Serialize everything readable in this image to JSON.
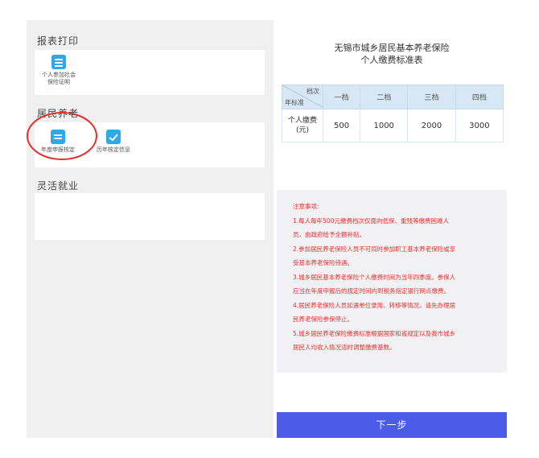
{
  "left": {
    "sections": {
      "print": {
        "title": "报表打印"
      },
      "pension": {
        "title": "居民养老"
      },
      "flex": {
        "title": "灵活就业"
      }
    },
    "tiles": {
      "insurance_cert": {
        "label_line1": "个人参加社会",
        "label_line2": "保险证明",
        "icon": "document-icon"
      },
      "annual_declare": {
        "label": "年度申报核定",
        "icon": "calendar-icon"
      },
      "history_check": {
        "label": "历年核定信息",
        "icon": "checked-calendar-icon"
      }
    }
  },
  "right": {
    "title_line1": "无锡市城乡居民基本养老保险",
    "title_line2": "个人缴费标准表",
    "table": {
      "corner_top": "档次",
      "corner_bottom": "年标准",
      "columns": [
        "一档",
        "二档",
        "三档",
        "四档"
      ],
      "row_label_line1": "个人缴费",
      "row_label_line2": "(元)",
      "values": [
        "500",
        "1000",
        "2000",
        "3000"
      ]
    },
    "notes": [
      "注意事项:",
      "1.每人每年500元缴费档次仅面向低保、重残等缴费困难人",
      "员，由政府给予全额补贴。",
      "2.参加居民养老保险人员不可同时参加职工基本养老保险或享",
      "受基本养老保险待遇。",
      "3.城乡居民基本养老保险个人缴费时间为当年四季度。参保人",
      "应当在年度申报后的规定时间内到税务指定银行网点缴费。",
      "4.居民养老保险人员如遇单位录用、转移等情况，请先办理居",
      "民养老保险参保停止。",
      "5.城乡居民养老保险缴费标准根据国家和省规定以及我市城乡",
      "居民人均收入情况适时调整缴费基数。"
    ],
    "next_button": "下一步"
  },
  "colors": {
    "accent": "#4a5ce8",
    "icon": "#2fa8e8",
    "warning": "#e23030",
    "annotation": "#e52d2d"
  }
}
